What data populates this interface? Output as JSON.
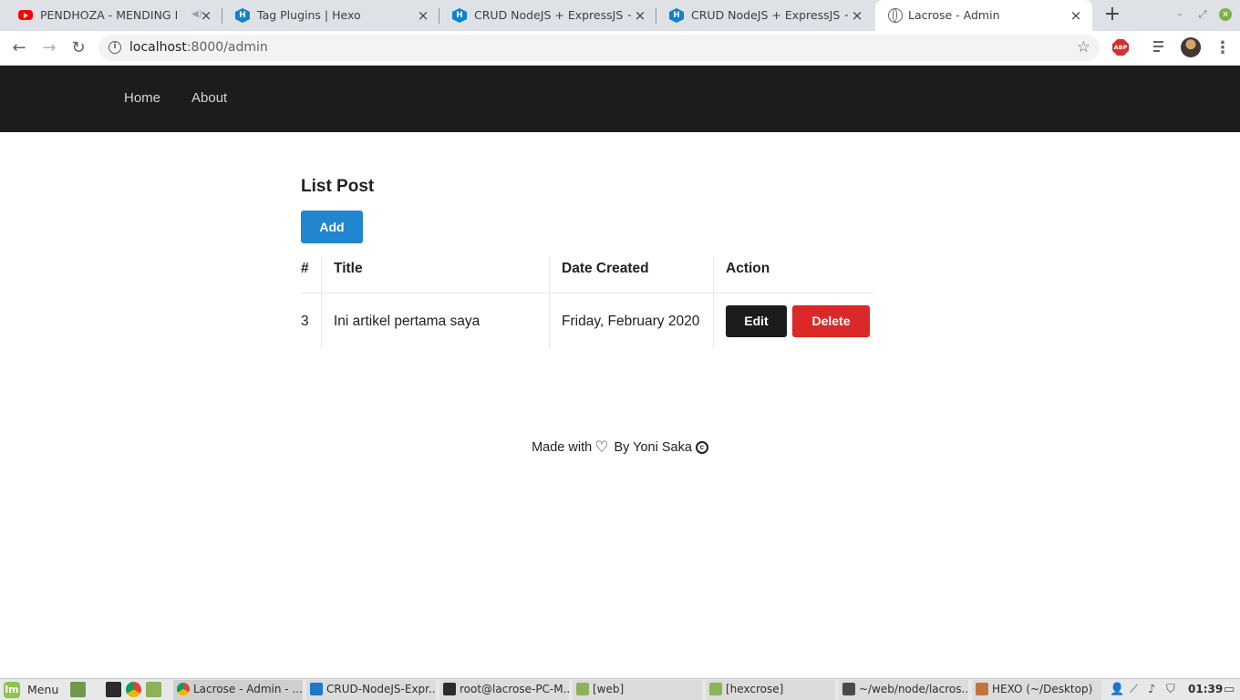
{
  "browser": {
    "tabs": [
      {
        "title": "PENDHOZA - MENDING PE",
        "favicon": "youtube-icon",
        "muted": true
      },
      {
        "title": "Tag Plugins | Hexo",
        "favicon": "hexo-icon"
      },
      {
        "title": "CRUD NodeJS + ExpressJS + Sequ",
        "favicon": "hexo-icon"
      },
      {
        "title": "CRUD NodeJS + ExpressJS + Sequ",
        "favicon": "hexo-icon"
      },
      {
        "title": "Lacrose - Admin",
        "favicon": "globe-icon",
        "active": true
      }
    ],
    "url_host": "localhost",
    "url_path": ":8000/admin"
  },
  "site": {
    "nav": [
      "Home",
      "About"
    ],
    "heading": "List Post",
    "add_label": "Add",
    "table": {
      "headers": [
        "#",
        "Title",
        "Date Created",
        "Action"
      ],
      "rows": [
        {
          "id": "3",
          "title": "Ini artikel pertama saya",
          "date": "Friday, February 2020"
        }
      ],
      "edit_label": "Edit",
      "delete_label": "Delete"
    },
    "footer": {
      "made_with": "Made with",
      "by": "By Yoni Saka"
    }
  },
  "taskbar": {
    "menu_label": "Menu",
    "tasks": [
      {
        "label": "Lacrose - Admin - ...",
        "icon": "chrome-icon",
        "active": true
      },
      {
        "label": "CRUD-NodeJS-Expr...",
        "icon": "vscode-icon"
      },
      {
        "label": "root@lacrose-PC-M...",
        "icon": "terminal-icon"
      },
      {
        "label": "[web]",
        "icon": "folder-icon"
      },
      {
        "label": "[hexcrose]",
        "icon": "folder-icon"
      },
      {
        "label": "~/web/node/lacros...",
        "icon": "sublime-icon"
      },
      {
        "label": "HEXO (~/Desktop)",
        "icon": "text-editor-icon"
      }
    ],
    "clock": "01:39"
  },
  "colors": {
    "nav_bg": "#1b1c1e",
    "add_button": "#2185d0",
    "edit_button": "#1b1c1d",
    "delete_button": "#db2828"
  }
}
